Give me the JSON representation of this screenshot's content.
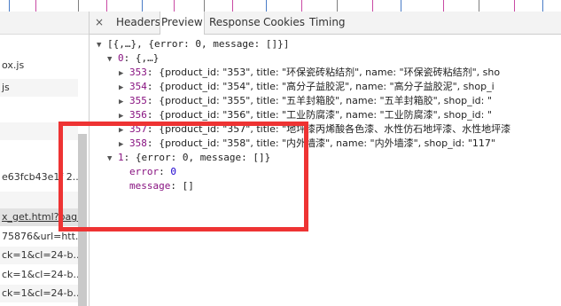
{
  "left_panel": {
    "rows": [
      {
        "text": "ox.js"
      },
      {
        "text": "js"
      },
      {
        "text": ""
      },
      {
        "text": ""
      },
      {
        "text": "e63fcb43e1f 2..."
      },
      {
        "text": ""
      },
      {
        "text": "x_get.html?pag..."
      },
      {
        "text": "75876&url=htt..."
      },
      {
        "text": "ck=1&cl=24-b..."
      },
      {
        "text": "ck=1&cl=24-b..."
      },
      {
        "text": "ck=1&cl=24-b..."
      }
    ]
  },
  "tabs": {
    "close": "×",
    "items": [
      {
        "label": "Headers"
      },
      {
        "label": "Preview"
      },
      {
        "label": "Response"
      },
      {
        "label": "Cookies"
      },
      {
        "label": "Timing"
      }
    ],
    "active": "Preview"
  },
  "preview": {
    "root": "[{,…}, {error: 0, message: []}]",
    "item0": {
      "index": "0",
      "summary": "{,…}"
    },
    "products": [
      {
        "id": "353",
        "rest": "{product_id: \"353\", title: \"环保瓷砖粘结剂\", name: \"环保瓷砖粘结剂\", sho"
      },
      {
        "id": "354",
        "rest": "{product_id: \"354\", title: \"高分子益胶泥\", name: \"高分子益胶泥\", shop_i"
      },
      {
        "id": "355",
        "rest": "{product_id: \"355\", title: \"五羊封箱胶\", name: \"五羊封箱胶\", shop_id: \""
      },
      {
        "id": "356",
        "rest": "{product_id: \"356\", title: \"工业防腐漆\", name: \"工业防腐漆\", shop_id: \""
      },
      {
        "id": "357",
        "rest": "{product_id: \"357\", title: \"地坪漆丙烯酸各色漆、水性仿石地坪漆、水性地坪漆"
      },
      {
        "id": "358",
        "rest": "{product_id: \"358\", title: \"内外墙漆\", name: \"内外墙漆\", shop_id: \"117\""
      }
    ],
    "item1": {
      "index": "1",
      "summary": "{error: 0, message: []}"
    },
    "error_key": "error",
    "error_value": "0",
    "message_key": "message",
    "message_value": "[]"
  },
  "colors": {
    "annotation": "#ee3333",
    "key": "#881280",
    "string": "#c41a16",
    "number": "#1c00cf"
  }
}
